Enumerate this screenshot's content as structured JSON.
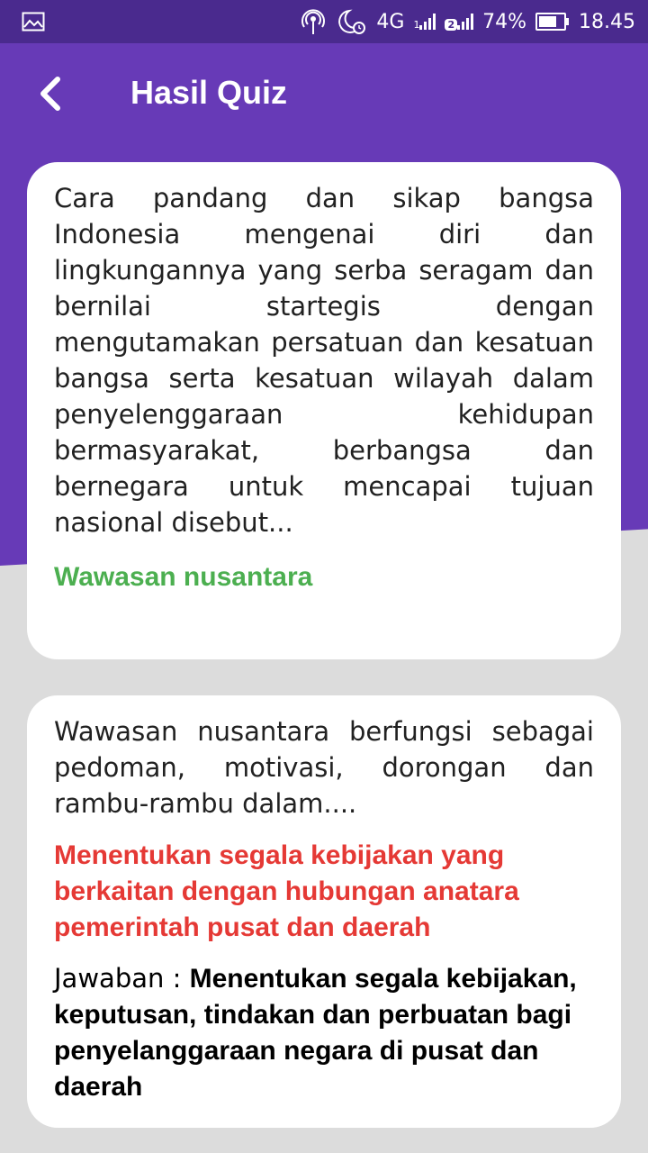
{
  "statusbar": {
    "network": "4G",
    "sim1": "1",
    "sim2": "2",
    "battery": "74%",
    "battery_level": 0.74,
    "time": "18.45",
    "icons": [
      "image-icon",
      "hotspot-icon",
      "moon-alarm-icon",
      "signal-icon",
      "battery-icon"
    ]
  },
  "appbar": {
    "title": "Hasil Quiz",
    "back_icon": "chevron-left-icon"
  },
  "colors": {
    "primary": "#673ab7",
    "statusbar": "#4a2a8e",
    "correct": "#4caf50",
    "wrong": "#e53935",
    "background": "#dcdcdc"
  },
  "results": [
    {
      "question": "Cara pandang dan sikap bangsa Indonesia mengenai diri dan lingkungannya yang serba seragam dan bernilai startegis dengan mengutamakan persatuan dan kesatuan bangsa serta kesatuan wilayah dalam penyelenggaraan kehidupan bermasyarakat, berbangsa dan bernegara untuk mencapai tujuan nasional disebut...",
      "selected_answer": "Wawasan nusantara",
      "correct": true
    },
    {
      "question": "Wawasan nusantara berfungsi sebagai pedoman, motivasi, dorongan dan rambu-rambu dalam....",
      "selected_answer": "Menentukan segala kebijakan yang berkaitan dengan hubungan anatara pemerintah pusat dan daerah",
      "correct": false,
      "answer_label": "Jawaban : ",
      "correct_answer": "Menentukan segala kebijakan, keputusan, tindakan dan perbuatan bagi penyelanggaraan negara di pusat dan daerah"
    }
  ]
}
